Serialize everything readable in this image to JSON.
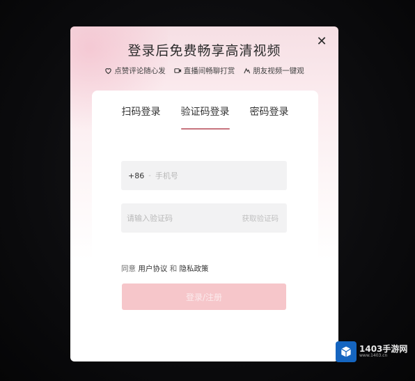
{
  "modal": {
    "title": "登录后免费畅享高清视频",
    "features": [
      {
        "icon": "heart-icon",
        "label": "点赞评论随心发"
      },
      {
        "icon": "camera-icon",
        "label": "直播间畅聊打赏"
      },
      {
        "icon": "share-icon",
        "label": "朋友视频一键观"
      }
    ],
    "close_label": "✕"
  },
  "tabs": [
    {
      "label": "扫码登录",
      "active": false
    },
    {
      "label": "验证码登录",
      "active": true
    },
    {
      "label": "密码登录",
      "active": false
    }
  ],
  "phone_field": {
    "prefix": "+86",
    "separator": "-",
    "placeholder": "手机号",
    "value": ""
  },
  "code_field": {
    "placeholder": "请输入验证码",
    "value": "",
    "get_code_label": "获取验证码"
  },
  "agreement": {
    "prefix": "同意",
    "terms": "用户协议",
    "and": "和",
    "privacy": "隐私政策"
  },
  "login_button": {
    "label": "登录/注册"
  },
  "colors": {
    "accent": "#c7737d",
    "button": "#f6c6ca",
    "field_bg": "#f2f2f3"
  },
  "watermark": {
    "text": "1403手游网",
    "sub": "www.1403.cn"
  }
}
